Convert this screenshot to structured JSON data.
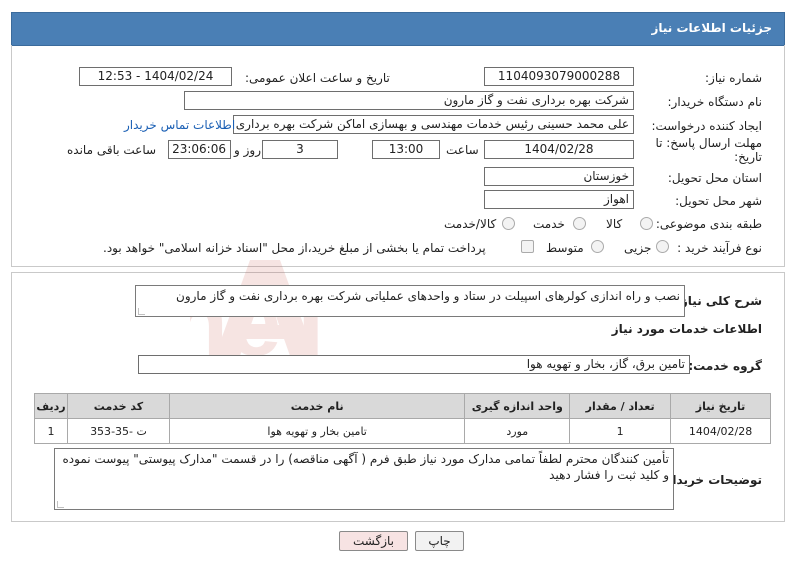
{
  "header": {
    "title": "جزئیات اطلاعات نیاز"
  },
  "fields": {
    "need_number_label": "شماره نیاز:",
    "need_number": "1104093079000288",
    "announce_label": "تاریخ و ساعت اعلان عمومی:",
    "announce_value": "1404/02/24 - 12:53",
    "buyer_org_label": "نام دستگاه خریدار:",
    "buyer_org": "شرکت بهره برداری نفت و گاز مارون",
    "creator_label": "ایجاد کننده درخواست:",
    "creator": "علی محمد حسینی رئیس خدمات مهندسی و بهسازی اماکن شرکت بهره برداری نفت و گاز مارون",
    "contact_link": "اطلاعات تماس خریدار",
    "deadline_label": "مهلت ارسال پاسخ: تا تاریخ:",
    "deadline_date": "1404/02/28",
    "time_label": "ساعت",
    "deadline_time": "13:00",
    "days_value": "3",
    "days_label": "روز و",
    "remaining_time": "23:06:06",
    "remaining_label": "ساعت باقی مانده",
    "province_label": "استان محل تحویل:",
    "province": "خوزستان",
    "city_label": "شهر محل تحویل:",
    "city": "اهواز",
    "category_label": "طبقه بندی موضوعی:",
    "category_options": [
      "کالا",
      "خدمت",
      "کالا/خدمت"
    ],
    "process_label": "نوع فرآیند خرید :",
    "process_options": [
      "جزیی",
      "متوسط"
    ],
    "payment_note": "پرداخت تمام یا بخشی از مبلغ خرید،از محل \"اسناد خزانه اسلامی\" خواهد بود."
  },
  "description": {
    "label": "شرح کلی نیاز:",
    "text": "نصب و راه اندازی کولرهای اسپیلت در ستاد و واحدهای عملیاتی شرکت بهره برداری نفت و گاز مارون"
  },
  "services": {
    "section_title": "اطلاعات خدمات مورد نیاز",
    "group_label": "گروه خدمت:",
    "group_value": "تامین برق، گاز، بخار و تهویه هوا",
    "columns": [
      "ردیف",
      "کد خدمت",
      "نام خدمت",
      "واحد اندازه گیری",
      "تعداد / مقدار",
      "تاریخ نیاز"
    ],
    "rows": [
      [
        "1",
        "ت -35-353",
        "تامین بخار و تهویه هوا",
        "مورد",
        "1",
        "1404/02/28"
      ]
    ]
  },
  "buyer_notes": {
    "label": "توضیحات خریدار:",
    "text": "تأمین کنندگان محترم لطفاً تمامی مدارک مورد نیاز طبق فرم ( آگهی مناقصه) را در قسمت \"مدارک پیوستی\" پیوست نموده و کلید ثبت را فشار دهید"
  },
  "buttons": {
    "print": "چاپ",
    "back": "بازگشت"
  },
  "watermark": {
    "text": "AriaTender.neT"
  },
  "colors": {
    "header_bg": "#4a7fb5",
    "link": "#1a5fb4",
    "back_btn_bg": "#f7e3e3",
    "watermark": "#c0392b"
  }
}
